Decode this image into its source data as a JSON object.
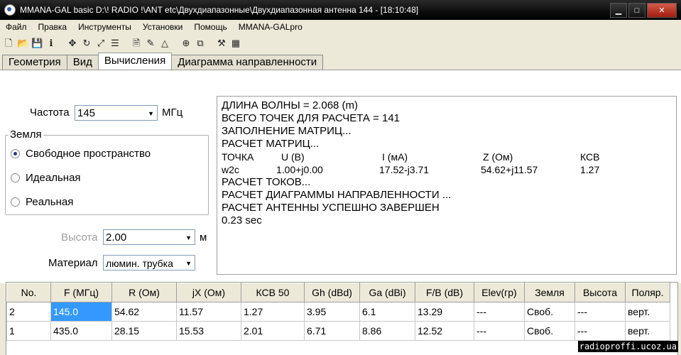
{
  "window": {
    "title": "MMANA-GAL basic D:\\! RADIO !\\ANT etc\\Двухдиапазонные\\Двухдиапазонная антенна 144 - [18:10:48]",
    "buttons": {
      "min": "▁",
      "max": "□",
      "close": "✕"
    }
  },
  "menu": [
    "Файл",
    "Правка",
    "Инструменты",
    "Установки",
    "Помощь",
    "MMANA-GALpro"
  ],
  "toolbar_icons": [
    "new-icon",
    "open-icon",
    "save-icon",
    "info-icon",
    "sep",
    "move-icon",
    "rotate-icon",
    "resize-icon",
    "wires-icon",
    "sep",
    "page-icon",
    "pen-icon",
    "triangle-icon",
    "sep",
    "target-icon",
    "copy-icon",
    "sep",
    "tools-icon",
    "calculator-icon"
  ],
  "tabs": [
    {
      "label": "Геометрия"
    },
    {
      "label": "Вид"
    },
    {
      "label": "Вычисления"
    },
    {
      "label": "Диаграмма направленности"
    }
  ],
  "frequency": {
    "label": "Частота",
    "value": "145",
    "unit": "МГц"
  },
  "ground": {
    "title": "Земля",
    "options": [
      "Свободное пространство",
      "Идеальная",
      "Реальная"
    ],
    "selected": 0
  },
  "height": {
    "label": "Высота",
    "value": "2.00",
    "unit": "м"
  },
  "material": {
    "label": "Материал",
    "value": "люмин. трубка"
  },
  "output": {
    "lines1": [
      "ДЛИНА ВОЛНЫ = 2.068 (m)",
      "ВСЕГО ТОЧЕК ДЛЯ РАСЧЕТА = 141",
      "ЗАПОЛНЕНИЕ МАТРИЦ...",
      "РАСЧЕТ МАТРИЦ..."
    ],
    "header": [
      "ТОЧКА",
      "U (В)",
      "I (мА)",
      "Z (Ом)",
      "КСВ"
    ],
    "row": [
      "w2c",
      "1.00+j0.00",
      "17.52-j3.71",
      "54.62+j11.57",
      "1.27"
    ],
    "lines2": [
      "РАСЧЕТ ТОКОВ...",
      "РАСЧЕТ ДИАГРАММЫ НАПРАВЛЕННОСТИ ...",
      "РАСЧЕТ АНТЕННЫ УСПЕШНО ЗАВЕРШЕН",
      "0.23 sec"
    ]
  },
  "table": {
    "headers": [
      "No.",
      "F (МГц)",
      "R (Ом)",
      "jX (Ом)",
      "КСВ 50",
      "Gh (dBd)",
      "Ga (dBi)",
      "F/B (dB)",
      "Elev(гр)",
      "Земля",
      "Высота",
      "Поляр."
    ],
    "rows": [
      [
        "2",
        "145.0",
        "54.62",
        "11.57",
        "1.27",
        "3.95",
        "6.1",
        "13.29",
        "---",
        "Своб.",
        "---",
        "верт."
      ],
      [
        "1",
        "435.0",
        "28.15",
        "15.53",
        "2.01",
        "6.71",
        "8.86",
        "12.52",
        "---",
        "Своб.",
        "---",
        "верт."
      ]
    ]
  },
  "watermark": "radioproffi.ucoz.ua"
}
